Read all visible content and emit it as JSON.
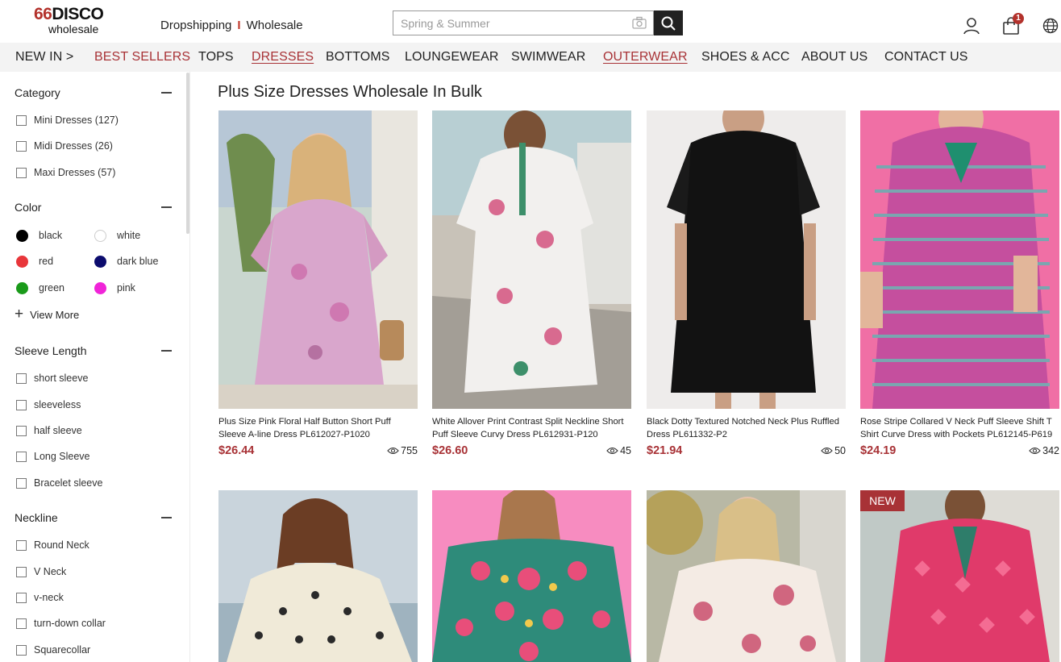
{
  "header": {
    "logo_number": "66",
    "logo_word": "DISCO",
    "logo_sub": "wholesale",
    "tagline_left": "Dropshipping",
    "tagline_sep": "I",
    "tagline_right": "Wholesale",
    "search": {
      "placeholder": "Spring & Summer",
      "value": ""
    },
    "cart_count": "1",
    "icons": [
      "camera-icon",
      "search-icon",
      "user-icon",
      "cart-icon",
      "globe-icon"
    ]
  },
  "nav": {
    "items": [
      {
        "label": "NEW IN >"
      },
      {
        "label": "BEST SELLERS"
      },
      {
        "label": "TOPS"
      },
      {
        "label": "DRESSES"
      },
      {
        "label": "BOTTOMS"
      },
      {
        "label": "LOUNGEWEAR"
      },
      {
        "label": "SWIMWEAR"
      },
      {
        "label": "OUTERWEAR"
      },
      {
        "label": "SHOES & ACC"
      },
      {
        "label": "ABOUT US"
      },
      {
        "label": "CONTACT US"
      }
    ]
  },
  "sidebar": {
    "category": {
      "title": "Category",
      "options": [
        "Mini Dresses (127)",
        "Midi Dresses (26)",
        "Maxi Dresses (57)"
      ]
    },
    "color": {
      "title": "Color",
      "options": [
        {
          "label": "black",
          "hex": "#000000"
        },
        {
          "label": "white",
          "hex": "#ffffff"
        },
        {
          "label": "red",
          "hex": "#e8363a"
        },
        {
          "label": "dark blue",
          "hex": "#0c0c6e"
        },
        {
          "label": "green",
          "hex": "#1a9a1a"
        },
        {
          "label": "pink",
          "hex": "#f024d8"
        }
      ],
      "view_more": "View More"
    },
    "sleeve": {
      "title": "Sleeve Length",
      "options": [
        "short sleeve",
        "sleeveless",
        "half sleeve",
        "Long Sleeve",
        "Bracelet sleeve"
      ]
    },
    "neckline": {
      "title": "Neckline",
      "options": [
        "Round Neck",
        "V Neck",
        "v-neck",
        "turn-down collar",
        "Squarecollar"
      ]
    }
  },
  "main": {
    "title": "Plus Size Dresses Wholesale In Bulk",
    "products": [
      {
        "title": "Plus Size Pink Floral Half Button Short Puff Sleeve A-line Dress PL612027-P1020",
        "price": "$26.44",
        "views": "755"
      },
      {
        "title": "White Allover Print Contrast Split Neckline Short Puff Sleeve Curvy Dress PL612931-P120",
        "price": "$26.60",
        "views": "45"
      },
      {
        "title": "Black Dotty Textured Notched Neck Plus Ruffled Dress PL611332-P2",
        "price": "$21.94",
        "views": "50"
      },
      {
        "title": "Rose Stripe Collared V Neck Puff Sleeve Shift T Shirt Curve Dress with Pockets PL612145-P619",
        "price": "$24.19",
        "views": "342"
      },
      {
        "badge": ""
      },
      {
        "badge": ""
      },
      {
        "badge": ""
      },
      {
        "badge": "NEW"
      }
    ]
  },
  "colors": {
    "accent": "#a83236",
    "nav_bg": "#f3f3f3",
    "search_btn": "#222222"
  }
}
